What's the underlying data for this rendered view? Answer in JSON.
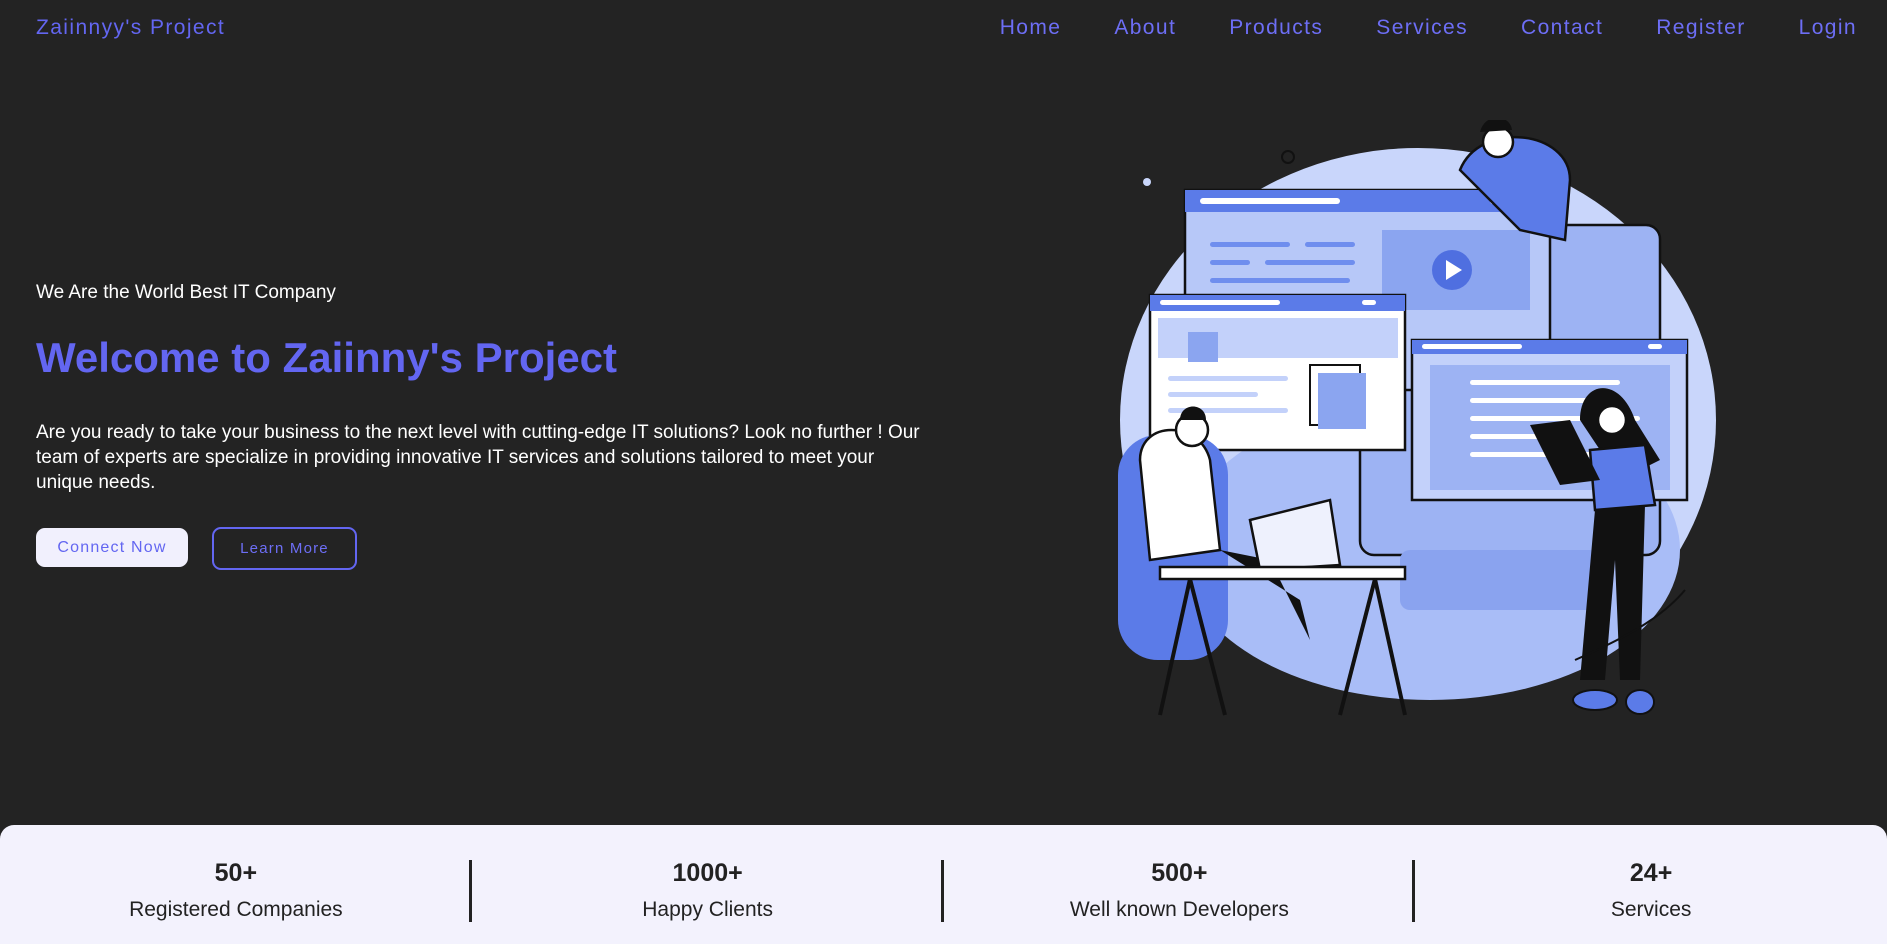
{
  "brand": "Zaiinnyy's Project",
  "nav": [
    "Home",
    "About",
    "Products",
    "Services",
    "Contact",
    "Register",
    "Login"
  ],
  "hero": {
    "tagline": "We Are the World Best IT Company",
    "title": "Welcome to Zaiinny's Project",
    "description": "Are you ready to take your business to the next level with cutting-edge IT solutions? Look no further ! Our team of experts are specialize in providing innovative IT services and solutions tailored to meet your unique needs.",
    "primary_button": "Connect Now",
    "secondary_button": "Learn More"
  },
  "stats": [
    {
      "value": "50+",
      "label": "Registered Companies"
    },
    {
      "value": "1000+",
      "label": "Happy Clients"
    },
    {
      "value": "500+",
      "label": "Well known Developers"
    },
    {
      "value": "24+",
      "label": "Services"
    }
  ],
  "colors": {
    "accent": "#6366f1",
    "background": "#232323",
    "stats_bg": "#f3f2fd"
  }
}
